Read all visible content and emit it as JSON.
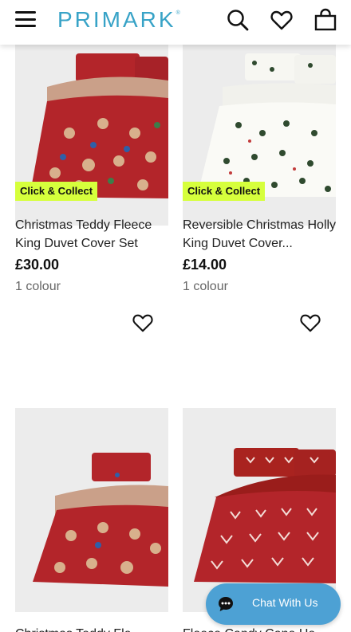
{
  "header": {
    "logo_text": "PRIMARK",
    "logo_mark": "®",
    "icons": [
      "menu-icon",
      "search-icon",
      "heart-icon",
      "bag-icon"
    ]
  },
  "products": [
    {
      "name": "Christmas Teddy Fleece King Duvet Cover Set",
      "price": "£30.00",
      "colours": "1 colour",
      "badge": "Click & Collect"
    },
    {
      "name": "Reversible Christmas Holly King Duvet Cover...",
      "price": "£14.00",
      "colours": "1 colour",
      "badge": "Click & Collect"
    },
    {
      "name": "Christmas Teddy Fle",
      "price": "",
      "colours": "",
      "badge": ""
    },
    {
      "name": "Fleece Candy Cane He",
      "price": "",
      "colours": "",
      "badge": ""
    }
  ],
  "chat": {
    "label": "Chat With Us"
  },
  "colors": {
    "accent": "#38a3c7",
    "badge": "#d6ff3c",
    "chat": "#4da1d4",
    "duvet_red": "#b3252a"
  }
}
